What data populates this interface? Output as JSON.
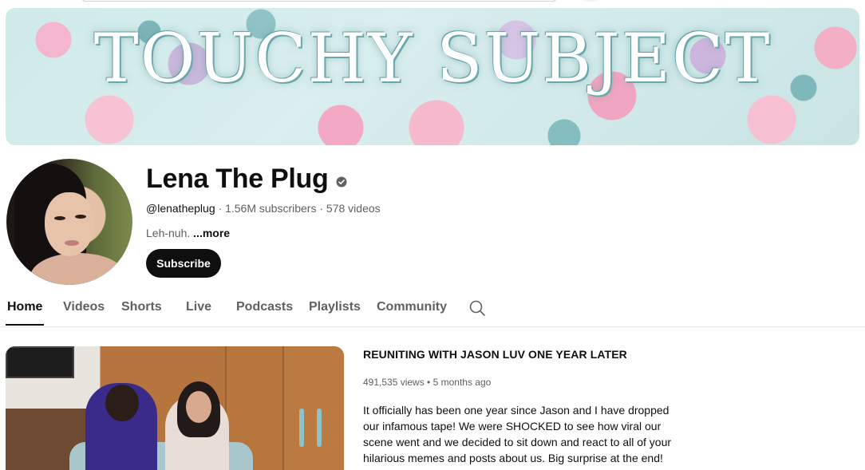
{
  "banner": {
    "title": "TOUCHY SUBJECT"
  },
  "channel": {
    "name": "Lena The Plug",
    "handle": "@lenatheplug",
    "separator": " · ",
    "subscribers": "1.56M subscribers",
    "videos": "578 videos",
    "description": "Leh-nuh.",
    "more_label": "...more",
    "subscribe_label": "Subscribe",
    "verified_icon": "verified-check-icon"
  },
  "tabs": [
    {
      "label": "Home",
      "active": true
    },
    {
      "label": "Videos",
      "active": false
    },
    {
      "label": "Shorts",
      "active": false
    },
    {
      "label": "Live",
      "active": false
    },
    {
      "label": "Podcasts",
      "active": false
    },
    {
      "label": "Playlists",
      "active": false
    },
    {
      "label": "Community",
      "active": false
    }
  ],
  "tab_search_icon": "search-icon",
  "featured_video": {
    "title": "REUNITING WITH JASON LUV ONE YEAR LATER",
    "views": "491,535 views",
    "dot": " • ",
    "age": "5 months ago",
    "description_lines": [
      "It officially has been one year since Jason and I have dropped",
      "our infamous tape! We were SHOCKED to see how viral our",
      "scene went and we decided to sit down and react to all of your",
      "hilarious memes and posts about us. Big surprise at the end!"
    ]
  },
  "colors": {
    "text_primary": "#0f0f0f",
    "text_secondary": "#606060",
    "subscribe_bg": "#0f0f0f",
    "divider": "#e5e5e5"
  }
}
